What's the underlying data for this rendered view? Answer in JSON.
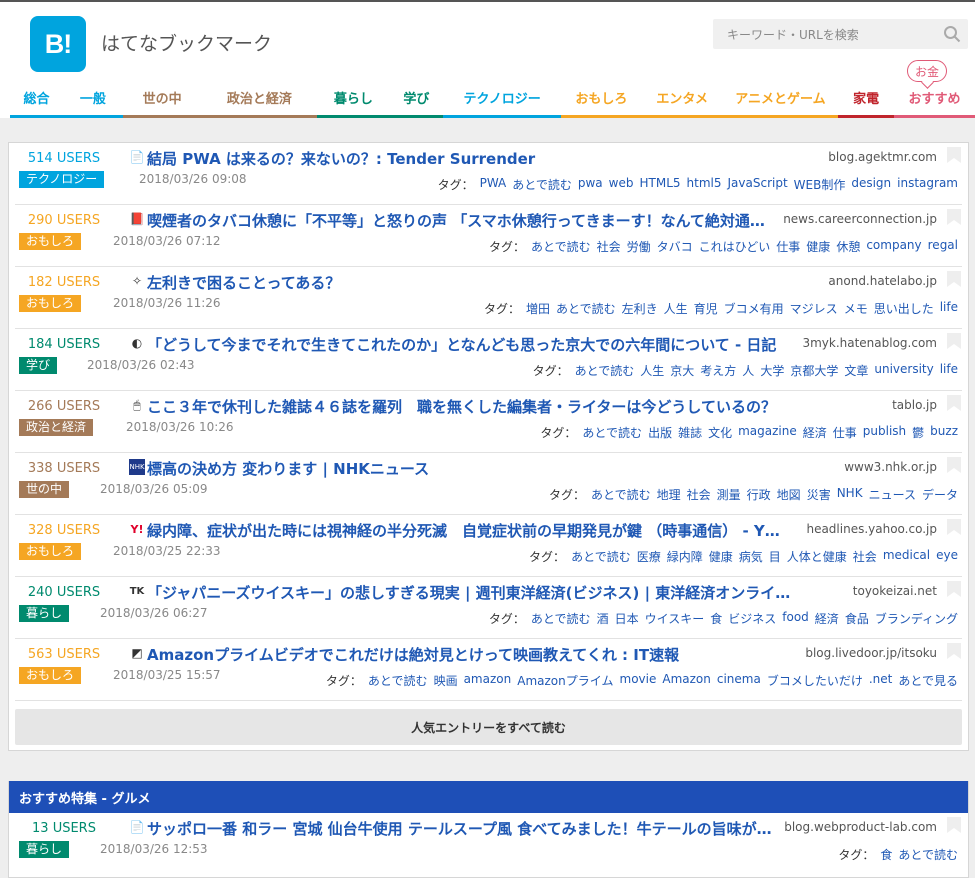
{
  "site": {
    "logo": "B!",
    "name": "はてなブックマーク"
  },
  "search": {
    "placeholder": "キーワード・URLを検索"
  },
  "okane_label": "お金",
  "nav": [
    {
      "label": "総合",
      "color": "#00a4de",
      "width": 55
    },
    {
      "label": "一般",
      "color": "#00a4de",
      "width": 62
    },
    {
      "label": "世の中",
      "color": "#a47a58",
      "width": 82
    },
    {
      "label": "政治と経済",
      "color": "#a47a58",
      "width": 120
    },
    {
      "label": "暮らし",
      "color": "#008a6e",
      "width": 75
    },
    {
      "label": "学び",
      "color": "#008a6e",
      "width": 56
    },
    {
      "label": "テクノロジー",
      "color": "#00a4de",
      "width": 122
    },
    {
      "label": "おもしろ",
      "color": "#f5a623",
      "width": 84
    },
    {
      "label": "エンタメ",
      "color": "#f5a623",
      "width": 84
    },
    {
      "label": "アニメとゲーム",
      "color": "#f5a623",
      "width": 120
    },
    {
      "label": "家電",
      "color": "#c0242c",
      "width": 58
    },
    {
      "label": "おすすめ",
      "color": "#e05a77",
      "width": 84
    }
  ],
  "entries": [
    {
      "users": "514 USERS",
      "users_color": "#00a4de",
      "category": "テクノロジー",
      "cat_color": "#00a4de",
      "title": "結局 PWA は来るの？来ないの？: Tender Surrender",
      "domain": "blog.agektmr.com",
      "date": "2018/03/26 09:08",
      "favicon": "📄",
      "tags": [
        "PWA",
        "あとで読む",
        "pwa",
        "web",
        "HTML5",
        "html5",
        "JavaScript",
        "WEB制作",
        "design",
        "instagram"
      ]
    },
    {
      "users": "290 USERS",
      "users_color": "#f5a623",
      "category": "おもしろ",
      "cat_color": "#f5a623",
      "title": "喫煙者のタバコ休憩に「不平等」と怒りの声 「スマホ休憩行ってきまーす！なんて絶対通…",
      "domain": "news.careerconnection.jp",
      "date": "2018/03/26 07:12",
      "favicon": "📕",
      "tags": [
        "あとで読む",
        "社会",
        "労働",
        "タバコ",
        "これはひどい",
        "仕事",
        "健康",
        "休憩",
        "company",
        "regal"
      ]
    },
    {
      "users": "182 USERS",
      "users_color": "#f5a623",
      "category": "おもしろ",
      "cat_color": "#f5a623",
      "title": "左利きで困ることってある？",
      "domain": "anond.hatelabo.jp",
      "date": "2018/03/26 11:26",
      "favicon": "✧",
      "tags": [
        "増田",
        "あとで読む",
        "左利き",
        "人生",
        "育児",
        "ブコメ有用",
        "マジレス",
        "メモ",
        "思い出した",
        "life"
      ]
    },
    {
      "users": "184 USERS",
      "users_color": "#008a6e",
      "category": "学び",
      "cat_color": "#008a6e",
      "title": "「どうして今までそれで生きてこれたのか」となんども思った京大での六年間について - 日記",
      "domain": "3myk.hatenablog.com",
      "date": "2018/03/26 02:43",
      "favicon": "◐",
      "tags": [
        "あとで読む",
        "人生",
        "京大",
        "考え方",
        "人",
        "大学",
        "京都大学",
        "文章",
        "university",
        "life"
      ]
    },
    {
      "users": "266 USERS",
      "users_color": "#a47a58",
      "category": "政治と経済",
      "cat_color": "#a47a58",
      "title": "ここ３年で休刊した雑誌４６誌を羅列　職を無くした編集者・ライターは今どうしているの？",
      "domain": "tablo.jp",
      "date": "2018/03/26 10:26",
      "favicon": "🖱",
      "tags": [
        "あとで読む",
        "出版",
        "雑誌",
        "文化",
        "magazine",
        "経済",
        "仕事",
        "publish",
        "鬱",
        "buzz"
      ]
    },
    {
      "users": "338 USERS",
      "users_color": "#a47a58",
      "category": "世の中",
      "cat_color": "#a47a58",
      "title": "標高の決め方 変わります | NHKニュース",
      "domain": "www3.nhk.or.jp",
      "date": "2018/03/26 05:09",
      "favicon": "NHK",
      "tags": [
        "あとで読む",
        "地理",
        "社会",
        "測量",
        "行政",
        "地図",
        "災害",
        "NHK",
        "ニュース",
        "データ"
      ]
    },
    {
      "users": "328 USERS",
      "users_color": "#f5a623",
      "category": "おもしろ",
      "cat_color": "#f5a623",
      "title": "緑内障、症状が出た時には視神経の半分死滅　自覚症状前の早期発見が鍵 （時事通信） - Y…",
      "domain": "headlines.yahoo.co.jp",
      "date": "2018/03/25 22:33",
      "favicon": "Y!",
      "tags": [
        "あとで読む",
        "医療",
        "緑内障",
        "健康",
        "病気",
        "目",
        "人体と健康",
        "社会",
        "medical",
        "eye"
      ]
    },
    {
      "users": "240 USERS",
      "users_color": "#008a6e",
      "category": "暮らし",
      "cat_color": "#008a6e",
      "title": "「ジャパニーズウイスキー」の悲しすぎる現実 | 週刊東洋経済(ビジネス) | 東洋経済オンライ…",
      "domain": "toyokeizai.net",
      "date": "2018/03/26 06:27",
      "favicon": "TK",
      "tags": [
        "あとで読む",
        "酒",
        "日本",
        "ウイスキー",
        "食",
        "ビジネス",
        "food",
        "経済",
        "食品",
        "ブランディング"
      ]
    },
    {
      "users": "563 USERS",
      "users_color": "#f5a623",
      "category": "おもしろ",
      "cat_color": "#f5a623",
      "title": "Amazonプライムビデオでこれだけは絶対見とけって映画教えてくれ : IT速報",
      "domain": "blog.livedoor.jp/itsoku",
      "date": "2018/03/25 15:57",
      "favicon": "◩",
      "tags": [
        "あとで読む",
        "映画",
        "amazon",
        "Amazonプライム",
        "movie",
        "Amazon",
        "cinema",
        "ブコメしたいだけ",
        ".net",
        "あとで見る"
      ]
    }
  ],
  "more_label": "人気エントリーをすべて読む",
  "tags_label": "タグ：",
  "feature": {
    "heading": "おすすめ特集 - グルメ",
    "entry": {
      "users": "13 USERS",
      "users_color": "#008a6e",
      "category": "暮らし",
      "cat_color": "#008a6e",
      "title": "サッポロ一番 和ラー 宮城 仙台牛使用 テールスープ風 食べてみました！牛テールの旨味が…",
      "domain": "blog.webproduct-lab.com",
      "date": "2018/03/26 12:53",
      "favicon": "📄",
      "tags": [
        "食",
        "あとで読む"
      ]
    }
  }
}
